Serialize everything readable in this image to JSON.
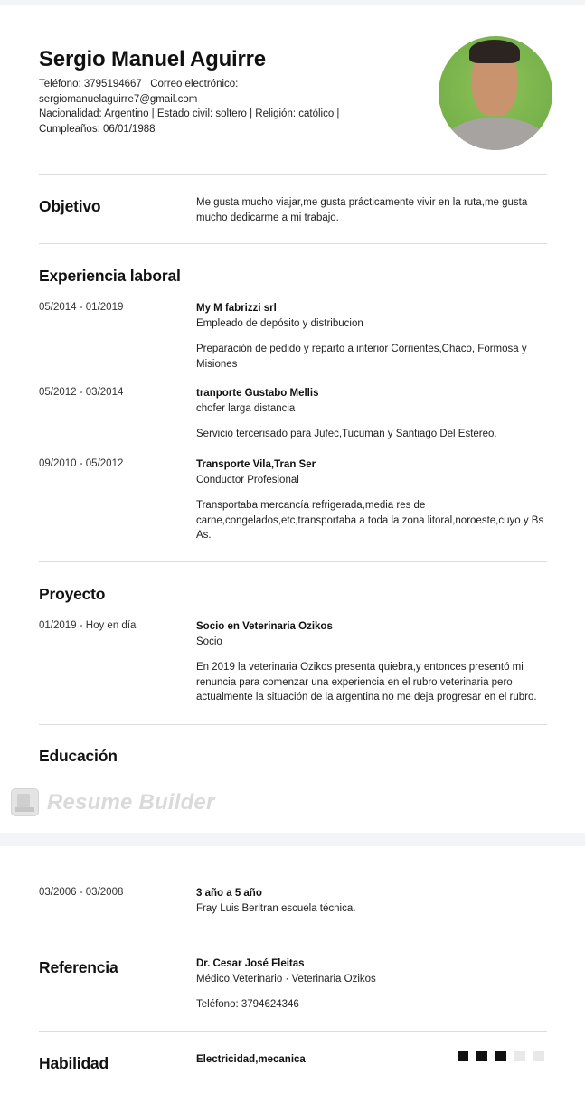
{
  "header": {
    "name": "Sergio Manuel Aguirre",
    "contact_line1": "Teléfono: 3795194667 | Correo electrónico:",
    "contact_line2": "sergiomanuelaguirre7@gmail.com",
    "contact_line3": "Nacionalidad: Argentino  | Estado civil: soltero | Religión: católico |",
    "contact_line4": "Cumpleaños: 06/01/1988"
  },
  "objective": {
    "title": "Objetivo",
    "text": "Me gusta mucho viajar,me gusta prácticamente vivir en la ruta,me gusta mucho dedicarme a mi trabajo."
  },
  "experience": {
    "title": "Experiencia laboral",
    "items": [
      {
        "date": "05/2014 - 01/2019",
        "company": "My M fabrizzi srl",
        "role": "Empleado de depósito y distribucion",
        "desc": "Preparación de pedido y reparto a interior Corrientes,Chaco, Formosa y Misiones"
      },
      {
        "date": "05/2012 - 03/2014",
        "company": "tranporte Gustabo Mellis",
        "role": "chofer larga distancia",
        "desc": "Servicio tercerisado para Jufec,Tucuman y Santiago Del Estéreo."
      },
      {
        "date": "09/2010 - 05/2012",
        "company": "Transporte Vila,Tran Ser",
        "role": "Conductor Profesional",
        "desc": "Transportaba mercancía refrigerada,media res de carne,congelados,etc,transportaba a toda la zona litoral,noroeste,cuyo y Bs As."
      }
    ]
  },
  "project": {
    "title": "Proyecto",
    "date": "01/2019 - Hoy en día",
    "name": "Socio en Veterinaria Ozikos",
    "role": "Socio",
    "desc": "En 2019 la veterinaria Ozikos presenta quiebra,y entonces presentó mi renuncia para comenzar una experiencia en el rubro veterinaria pero actualmente la situación de la argentina no me deja progresar en el rubro."
  },
  "education": {
    "title": "Educación",
    "date": "03/2006 - 03/2008",
    "degree": "3 año a 5 año",
    "school": "Fray Luis Berltran escuela técnica."
  },
  "reference": {
    "title": "Referencia",
    "name": "Dr. Cesar José Fleitas",
    "role": "Médico Veterinario · Veterinaria Ozikos",
    "phone": "Teléfono: 3794624346"
  },
  "skills": {
    "title": "Habilidad",
    "name": "Electricidad,mecanica",
    "level": 3,
    "max": 5
  },
  "watermark": {
    "text": "Resume Builder",
    "icon": "resume-builder-app-icon"
  },
  "colors": {
    "background": "#f3f4f7",
    "page": "#ffffff",
    "text": "#1b1b1b",
    "divider": "#dcdcdc",
    "skill_on": "#111111",
    "skill_off": "#e8e8e8"
  }
}
